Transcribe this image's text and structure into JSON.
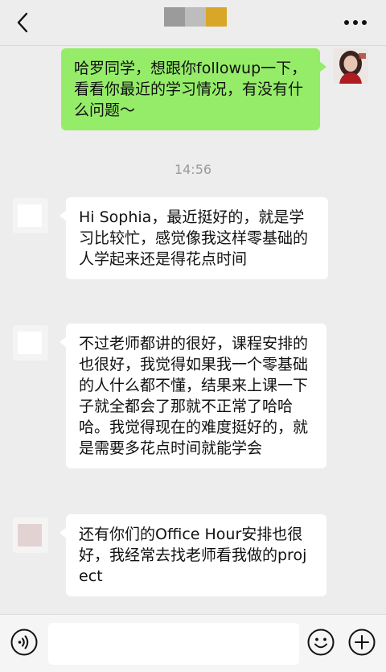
{
  "header": {
    "title_colors": [
      "#9b9b9b",
      "#bdbdbd",
      "#d9a728"
    ],
    "back_icon": "chevron-left-icon",
    "more_icon": "more-dots-icon"
  },
  "messages": [
    {
      "direction": "out",
      "text": "哈罗同学，想跟你followup一下，看看你最近的学习情况，有没有什么问题～"
    },
    {
      "direction": "timestamp",
      "text": "14:56"
    },
    {
      "direction": "in",
      "text": "Hi Sophia，最近挺好的，就是学习比较忙，感觉像我这样零基础的人学起来还是得花点时间"
    },
    {
      "direction": "in",
      "text": "不过老师都讲的很好，课程安排的也很好，我觉得如果我一个零基础的人什么都不懂，结果来上课一下子就全都会了那就不正常了哈哈哈。我觉得现在的难度挺好的，就是需要多花点时间就能学会"
    },
    {
      "direction": "in",
      "text": "还有你们的Office Hour安排也很好，我经常去找老师看我做的project"
    }
  ],
  "input_bar": {
    "voice_icon": "voice-icon",
    "emoji_icon": "emoji-icon",
    "add_icon": "plus-icon",
    "text_value": ""
  },
  "colors": {
    "background": "#ededed",
    "outgoing_bubble": "#95ec69",
    "incoming_bubble": "#ffffff"
  }
}
